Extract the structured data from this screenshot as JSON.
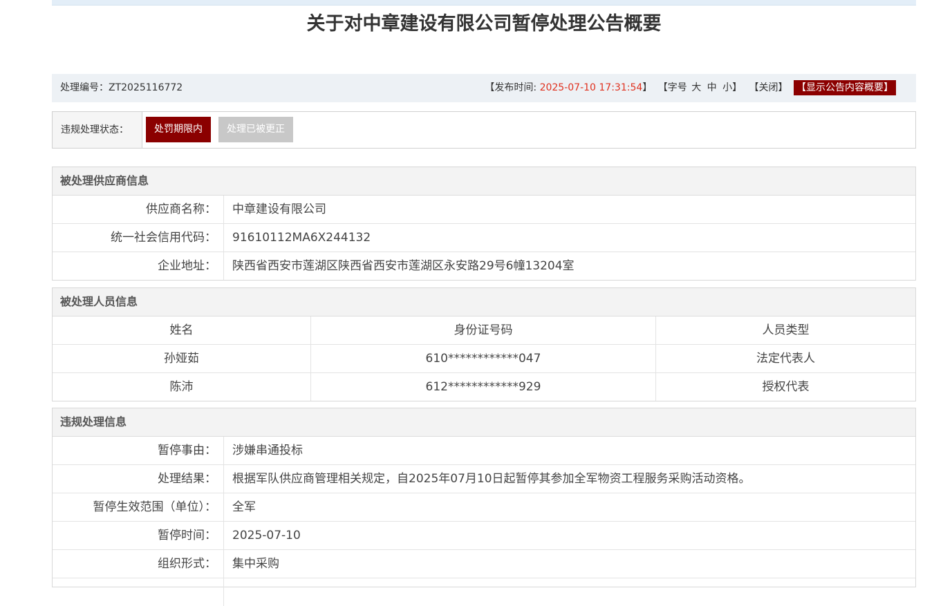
{
  "title": "关于对中章建设有限公司暂停处理公告概要",
  "info": {
    "code_label": "处理编号：",
    "code": "ZT2025116772",
    "publish_label": "【发布时间: ",
    "publish_time": "2025-07-10 17:31:54",
    "publish_end": "】",
    "font_label": "【字号",
    "font_large": "大",
    "font_medium": "中",
    "font_small": "小】",
    "close": "【关闭】",
    "show_summary": "【显示公告内容概要】"
  },
  "status": {
    "label": "违规处理状态：",
    "active_tag": "处罚期限内",
    "inactive_tag": "处理已被更正"
  },
  "supplier": {
    "heading": "被处理供应商信息",
    "rows": [
      {
        "key": "供应商名称：",
        "value": "中章建设有限公司"
      },
      {
        "key": "统一社会信用代码：",
        "value": "91610112MA6X244132"
      },
      {
        "key": "企业地址：",
        "value": "陕西省西安市莲湖区陕西省西安市莲湖区永安路29号6幢13204室"
      }
    ]
  },
  "persons": {
    "heading": "被处理人员信息",
    "columns": [
      "姓名",
      "身份证号码",
      "人员类型"
    ],
    "rows": [
      [
        "孙娅茹",
        "610************047",
        "法定代表人"
      ],
      [
        "陈沛",
        "612************929",
        "授权代表"
      ]
    ]
  },
  "violation": {
    "heading": "违规处理信息",
    "rows": [
      {
        "key": "暂停事由：",
        "value": "涉嫌串通投标"
      },
      {
        "key": "处理结果：",
        "value": "根据军队供应商管理相关规定，自2025年07月10日起暂停其参加全军物资工程服务采购活动资格。"
      },
      {
        "key": "暂停生效范围（单位）：",
        "value": "全军"
      },
      {
        "key": "暂停时间：",
        "value": "2025-07-10"
      },
      {
        "key": "组织形式：",
        "value": "集中采购"
      },
      {
        "key": "",
        "value": ""
      }
    ]
  },
  "colors": {
    "accent": "#8b0000",
    "time_red": "#e0301e",
    "inactive_tag": "#c8c8c8"
  }
}
